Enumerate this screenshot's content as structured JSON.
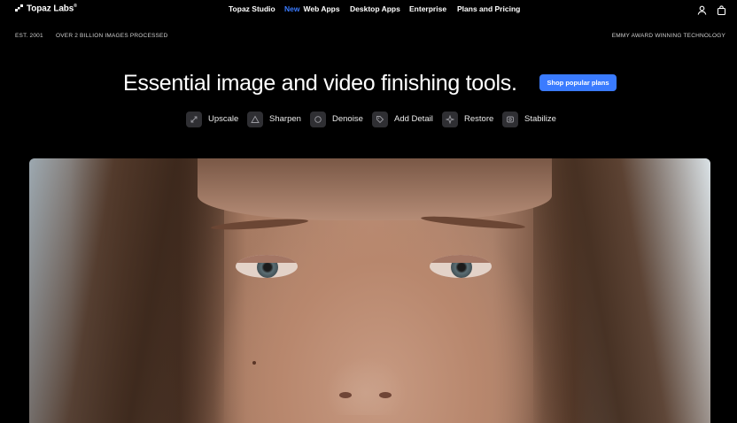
{
  "brand": {
    "name": "Topaz Labs",
    "mark": "®"
  },
  "nav": {
    "links": [
      {
        "label": "Topaz Studio"
      },
      {
        "badge": "New",
        "label": "Web Apps"
      },
      {
        "label": "Desktop Apps"
      },
      {
        "label": "Enterprise"
      },
      {
        "label": "Plans and Pricing"
      }
    ],
    "icons": [
      "user-icon",
      "bag-icon"
    ]
  },
  "strip": {
    "est": "EST. 2001",
    "processed": "OVER 2 BILLION IMAGES PROCESSED",
    "award": "EMMY AWARD WINNING TECHNOLOGY"
  },
  "hero": {
    "title": "Essential image and video finishing tools.",
    "cta": "Shop popular plans"
  },
  "tools": [
    {
      "label": "Upscale",
      "icon": "expand-icon"
    },
    {
      "label": "Sharpen",
      "icon": "triangle-icon"
    },
    {
      "label": "Denoise",
      "icon": "circle-icon"
    },
    {
      "label": "Add Detail",
      "icon": "tag-icon"
    },
    {
      "label": "Restore",
      "icon": "sparkle-icon"
    },
    {
      "label": "Stabilize",
      "icon": "stabilize-icon"
    }
  ],
  "colors": {
    "accent": "#3a7bff",
    "background": "#000000",
    "tool_tile": "#2f2f33"
  }
}
